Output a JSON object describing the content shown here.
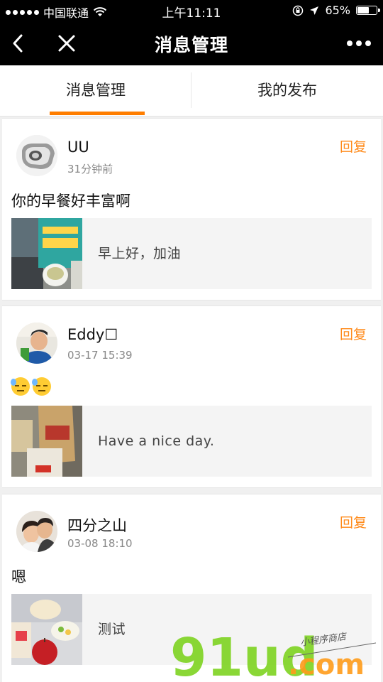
{
  "status_bar": {
    "carrier": "中国联通",
    "time": "上午11:11",
    "battery": "65%",
    "battery_level": 0.65
  },
  "nav": {
    "title": "消息管理",
    "back_icon": "chevron-left-icon",
    "close_icon": "close-icon",
    "more_icon": "more-icon"
  },
  "tabs": [
    {
      "label": "消息管理",
      "active": true
    },
    {
      "label": "我的发布",
      "active": false
    }
  ],
  "messages": [
    {
      "name": "UU",
      "time": "31分钟前",
      "reply": "回复",
      "content": "你的早餐好丰富啊",
      "quote": "早上好，加油"
    },
    {
      "name": "Eddy☐",
      "time": "03-17 15:39",
      "reply": "回复",
      "content": "",
      "quote": "Have a nice day."
    },
    {
      "name": "四分之山",
      "time": "03-08 18:10",
      "reply": "回复",
      "content": "嗯",
      "quote": "测试"
    }
  ],
  "watermark": {
    "brand": "91ud",
    "domain": ".com",
    "tagline": "小程序商店"
  },
  "colors": {
    "accent": "#ff7e00",
    "reply": "#ff8a1a",
    "bar": "#000000"
  }
}
